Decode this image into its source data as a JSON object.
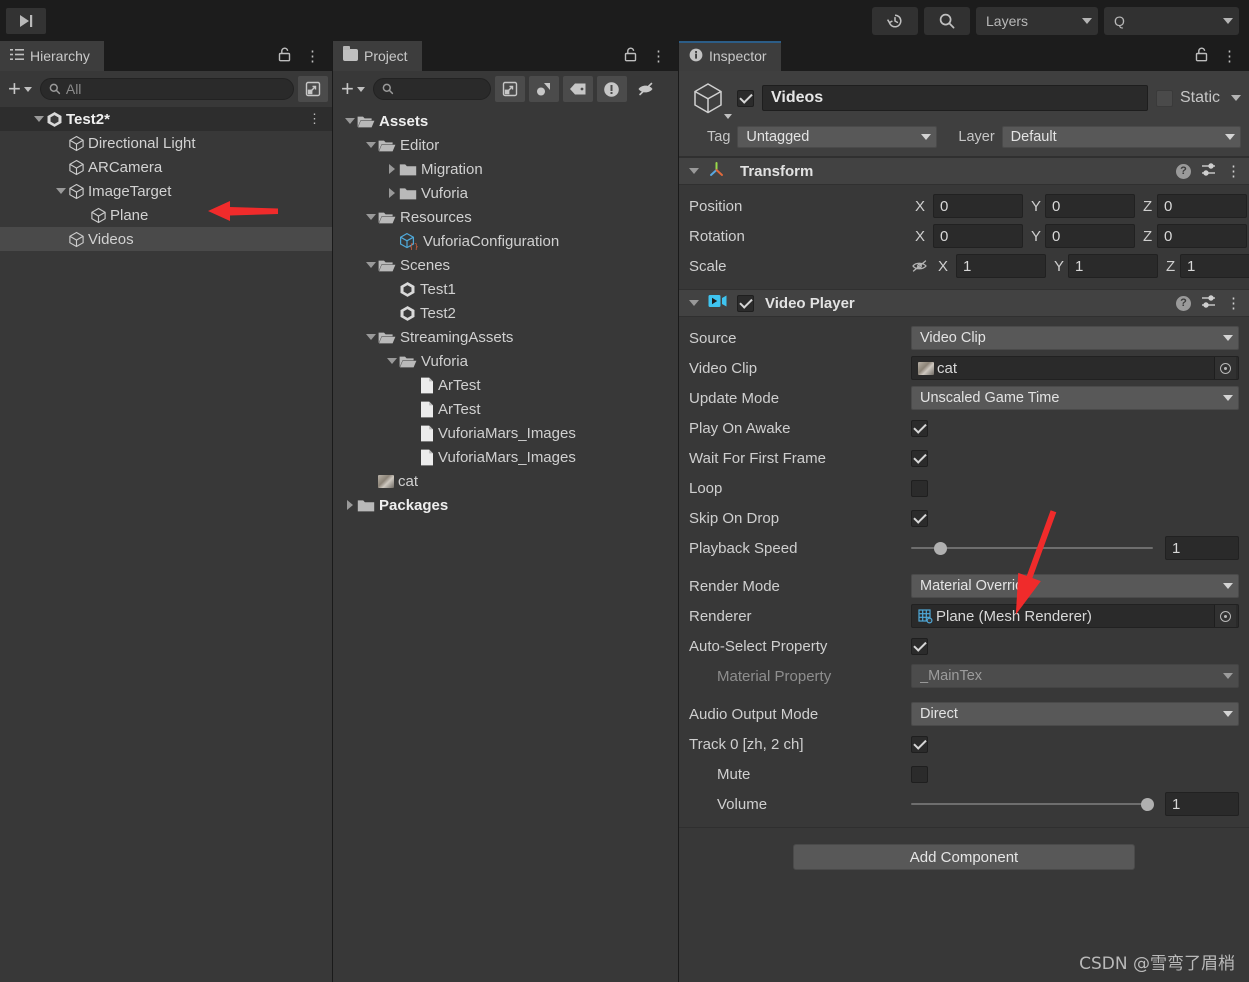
{
  "toolbar": {
    "step_icon": "step-forward-icon",
    "history_icon": "history-icon",
    "search_icon": "search-icon",
    "layers_label": "Layers",
    "layout_label": "Q"
  },
  "hierarchy": {
    "tab_label": "Hierarchy",
    "tab_icon": "hierarchy-icon",
    "lock_icon": "lock-icon",
    "kebab_icon": "kebab-icon",
    "add_label": "+",
    "search_placeholder": "All",
    "items": [
      {
        "label": "Test2*",
        "depth": 0,
        "tri": "down",
        "icon": "unity-scene-icon",
        "bold": true,
        "state": "root"
      },
      {
        "label": "Directional Light",
        "depth": 1,
        "tri": "none",
        "icon": "gameobject-icon",
        "state": ""
      },
      {
        "label": "ARCamera",
        "depth": 1,
        "tri": "none",
        "icon": "gameobject-icon",
        "state": ""
      },
      {
        "label": "ImageTarget",
        "depth": 1,
        "tri": "down",
        "icon": "gameobject-icon",
        "state": ""
      },
      {
        "label": "Plane",
        "depth": 2,
        "tri": "none",
        "icon": "gameobject-icon",
        "state": ""
      },
      {
        "label": "Videos",
        "depth": 1,
        "tri": "none",
        "icon": "gameobject-icon",
        "state": "selected"
      }
    ]
  },
  "project": {
    "tab_label": "Project",
    "tab_icon": "folder-icon",
    "lock_icon": "lock-icon",
    "kebab_icon": "kebab-icon",
    "add_label": "+",
    "search_placeholder": "",
    "toolbar_icons": [
      "expand-icon",
      "favorites-icon",
      "label-icon",
      "warning-icon",
      "hidden-eye-icon"
    ],
    "items": [
      {
        "label": "Assets",
        "depth": 0,
        "tri": "down",
        "icon": "folder-open-icon",
        "bold": true
      },
      {
        "label": "Editor",
        "depth": 1,
        "tri": "down",
        "icon": "folder-open-icon",
        "bold": false
      },
      {
        "label": "Migration",
        "depth": 2,
        "tri": "right",
        "icon": "folder-icon",
        "bold": false
      },
      {
        "label": "Vuforia",
        "depth": 2,
        "tri": "right",
        "icon": "folder-icon",
        "bold": false
      },
      {
        "label": "Resources",
        "depth": 1,
        "tri": "down",
        "icon": "folder-open-icon",
        "bold": false
      },
      {
        "label": "VuforiaConfiguration",
        "depth": 2,
        "tri": "none",
        "icon": "scriptableobject-icon",
        "bold": false
      },
      {
        "label": "Scenes",
        "depth": 1,
        "tri": "down",
        "icon": "folder-open-icon",
        "bold": false
      },
      {
        "label": "Test1",
        "depth": 2,
        "tri": "none",
        "icon": "unity-scene-icon",
        "bold": false
      },
      {
        "label": "Test2",
        "depth": 2,
        "tri": "none",
        "icon": "unity-scene-icon",
        "bold": false
      },
      {
        "label": "StreamingAssets",
        "depth": 1,
        "tri": "down",
        "icon": "folder-open-icon",
        "bold": false
      },
      {
        "label": "Vuforia",
        "depth": 2,
        "tri": "down",
        "icon": "folder-open-icon",
        "bold": false
      },
      {
        "label": "ArTest",
        "depth": 3,
        "tri": "none",
        "icon": "document-icon",
        "bold": false
      },
      {
        "label": "ArTest",
        "depth": 3,
        "tri": "none",
        "icon": "document-icon",
        "bold": false
      },
      {
        "label": "VuforiaMars_Images",
        "depth": 3,
        "tri": "none",
        "icon": "document-icon",
        "bold": false
      },
      {
        "label": "VuforiaMars_Images",
        "depth": 3,
        "tri": "none",
        "icon": "document-icon",
        "bold": false
      },
      {
        "label": "cat",
        "depth": 1,
        "tri": "none",
        "icon": "video-thumbnail-icon",
        "bold": false
      },
      {
        "label": "Packages",
        "depth": 0,
        "tri": "right",
        "icon": "folder-icon",
        "bold": true
      }
    ]
  },
  "inspector": {
    "tab_label": "Inspector",
    "tab_icon": "info-icon",
    "lock_icon": "lock-icon",
    "kebab_icon": "kebab-icon",
    "gameobject": {
      "icon": "gameobject-icon",
      "enabled": true,
      "name": "Videos",
      "static_label": "Static",
      "static_checked": false,
      "tag_label": "Tag",
      "tag_value": "Untagged",
      "layer_label": "Layer",
      "layer_value": "Default"
    },
    "transform": {
      "title": "Transform",
      "icon": "transform-axis-icon",
      "help_icon": "help-icon",
      "preset_icon": "preset-icon",
      "kebab_icon": "kebab-icon",
      "rows": [
        {
          "label": "Position",
          "x": "0",
          "y": "0",
          "z": "0"
        },
        {
          "label": "Rotation",
          "x": "0",
          "y": "0",
          "z": "0"
        },
        {
          "label": "Scale",
          "x": "1",
          "y": "1",
          "z": "1",
          "extra_icon": "constrain-proportions-off-icon"
        }
      ],
      "axes": [
        "X",
        "Y",
        "Z"
      ]
    },
    "video_player": {
      "title": "Video Player",
      "icon": "video-player-icon",
      "enabled": true,
      "help_icon": "help-icon",
      "preset_icon": "preset-icon",
      "kebab_icon": "kebab-icon",
      "source_label": "Source",
      "source_value": "Video Clip",
      "video_clip_label": "Video Clip",
      "video_clip_value": "cat",
      "update_mode_label": "Update Mode",
      "update_mode_value": "Unscaled Game Time",
      "play_on_awake_label": "Play On Awake",
      "play_on_awake": true,
      "wait_first_frame_label": "Wait For First Frame",
      "wait_first_frame": true,
      "loop_label": "Loop",
      "loop": false,
      "skip_on_drop_label": "Skip On Drop",
      "skip_on_drop": true,
      "playback_speed_label": "Playback Speed",
      "playback_speed_value": "1",
      "playback_speed_pct": 12,
      "render_mode_label": "Render Mode",
      "render_mode_value": "Material Override",
      "renderer_label": "Renderer",
      "renderer_value": "Plane (Mesh Renderer)",
      "auto_select_label": "Auto-Select Property",
      "auto_select": true,
      "material_property_label": "Material Property",
      "material_property_value": "_MainTex",
      "audio_output_label": "Audio Output Mode",
      "audio_output_value": "Direct",
      "track_label": "Track 0 [zh, 2 ch]",
      "track_enabled": true,
      "mute_label": "Mute",
      "mute": false,
      "volume_label": "Volume",
      "volume_value": "1",
      "volume_pct": 100
    },
    "add_component_label": "Add Component"
  },
  "annotations": {
    "arrow_hierarchy": "red-arrow-pointing-left",
    "arrow_render_mode": "red-arrow-pointing-down-left"
  },
  "watermark": "CSDN @雪弯了眉梢",
  "colors": {
    "panel_bg": "#383838",
    "chrome_bg": "#1c1c1c",
    "accent_blue": "#2c5d87",
    "arrow_red": "#f03030",
    "selected_row": "#4a4a4a"
  }
}
